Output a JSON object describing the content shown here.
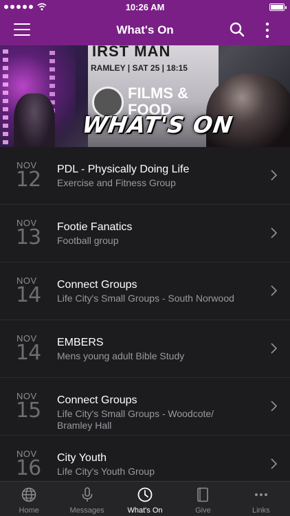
{
  "status_bar": {
    "time": "10:26 AM"
  },
  "nav": {
    "title": "What's On"
  },
  "banner": {
    "caption": "WHAT'S ON",
    "screen_line1": "IRST MAN",
    "screen_line2": "RAMLEY | SAT 25 | 18:15",
    "screen_line3": "FILMS & FOOD"
  },
  "events": [
    {
      "month": "NOV",
      "day": "12",
      "title": "PDL - Physically Doing Life",
      "subtitle": "Exercise and Fitness Group"
    },
    {
      "month": "NOV",
      "day": "13",
      "title": "Footie Fanatics",
      "subtitle": "Football group"
    },
    {
      "month": "NOV",
      "day": "14",
      "title": "Connect Groups",
      "subtitle": "Life City's Small Groups - South Norwood"
    },
    {
      "month": "NOV",
      "day": "14",
      "title": "EMBERS",
      "subtitle": "Mens young adult Bible Study"
    },
    {
      "month": "NOV",
      "day": "15",
      "title": "Connect Groups",
      "subtitle": "Life City's Small Groups - Woodcote/ Bramley Hall"
    },
    {
      "month": "NOV",
      "day": "16",
      "title": "City Youth",
      "subtitle": "Life City's Youth Group"
    }
  ],
  "tabs": [
    {
      "label": "Home",
      "icon": "globe-icon",
      "active": false
    },
    {
      "label": "Messages",
      "icon": "microphone-icon",
      "active": false
    },
    {
      "label": "What's On",
      "icon": "clock-icon",
      "active": true
    },
    {
      "label": "Give",
      "icon": "book-icon",
      "active": false
    },
    {
      "label": "Links",
      "icon": "more-dots-icon",
      "active": false
    }
  ],
  "colors": {
    "accent": "#7a1f86",
    "background": "#1c1c1e",
    "tab_bar": "#252527"
  }
}
